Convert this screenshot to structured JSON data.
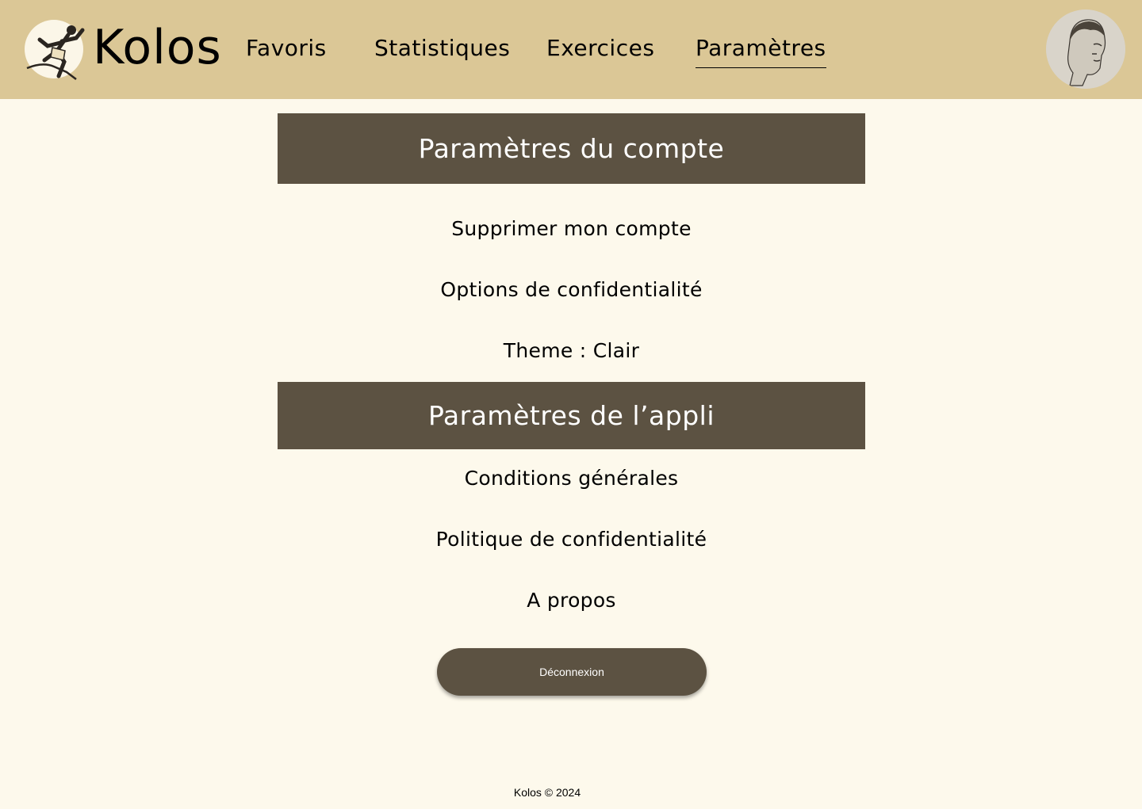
{
  "app": {
    "brand": "Kolos",
    "logo_icon": "running-athlete-icon"
  },
  "nav": {
    "items": [
      {
        "label": "Favoris",
        "active": false
      },
      {
        "label": "Statistiques",
        "active": false
      },
      {
        "label": "Exercices",
        "active": false
      },
      {
        "label": "Paramètres",
        "active": true
      }
    ]
  },
  "profile": {
    "avatar_icon": "greek-statue-avatar"
  },
  "account_section": {
    "title": "Paramètres du compte",
    "options": [
      "Supprimer mon compte",
      "Options de confidentialité",
      "Theme : Clair"
    ]
  },
  "app_section": {
    "title": "Paramètres de l’appli",
    "options": [
      "Conditions générales",
      "Politique de confidentialité",
      "A propos"
    ]
  },
  "logout": {
    "label": "Déconnexion"
  },
  "footer": {
    "text": "Kolos © 2024"
  },
  "colors": {
    "header_bg": "#dbc796",
    "page_bg": "#fdf9ec",
    "section_bg": "#5c5242",
    "button_bg": "#5c5242"
  }
}
